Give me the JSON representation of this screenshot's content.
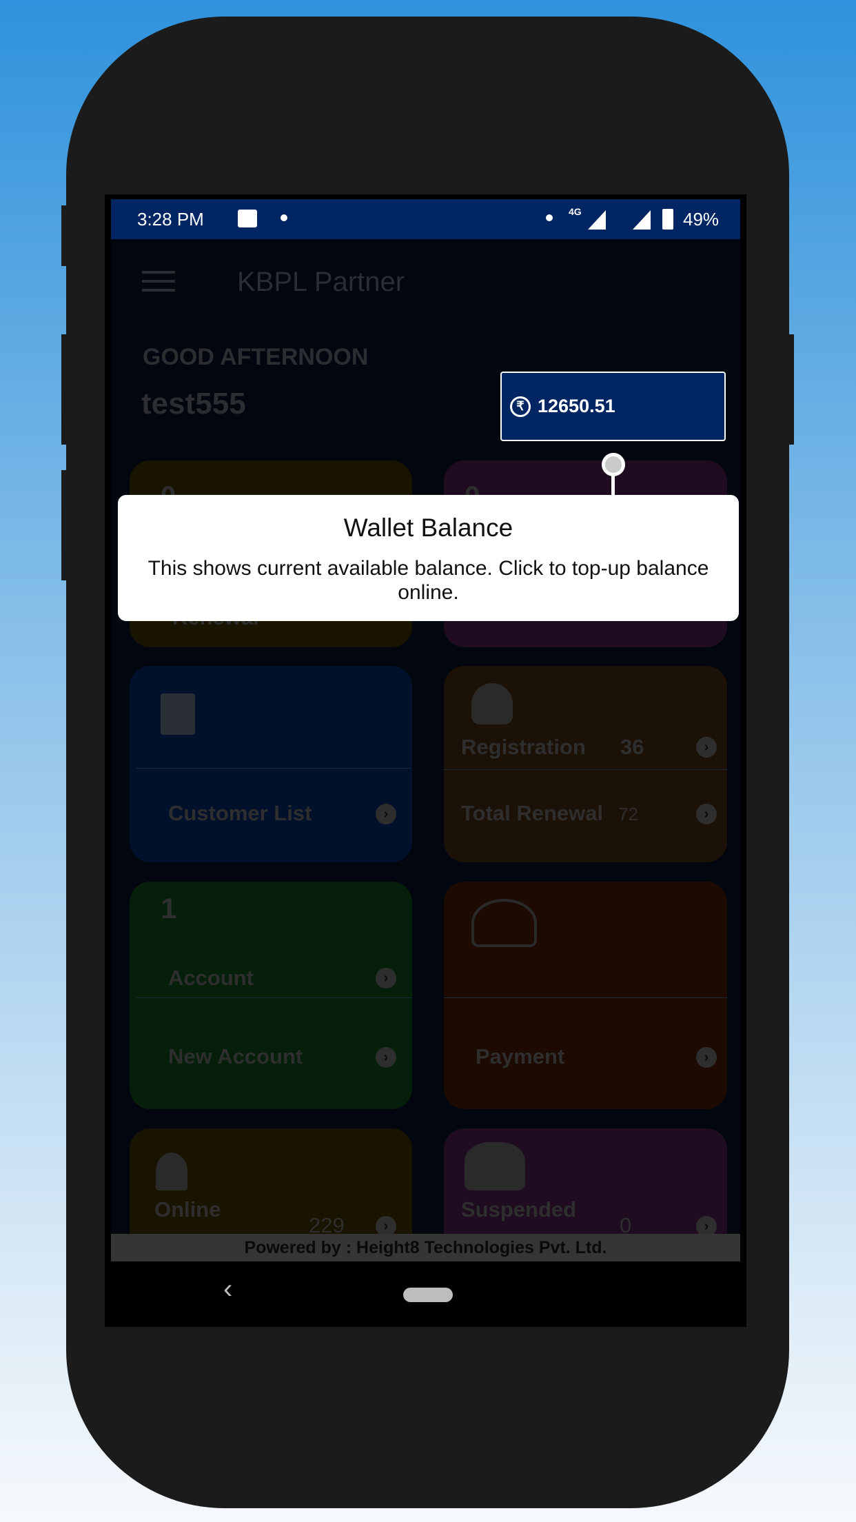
{
  "status_bar": {
    "time": "3:28 PM",
    "network": "4G",
    "battery": "49%"
  },
  "app_bar": {
    "title": "KBPL Partner",
    "menu_icon": "hamburger-icon"
  },
  "greeting": "GOOD AFTERNOON",
  "username": "test555",
  "wallet": {
    "amount": "12650.51",
    "icon": "rupee-icon"
  },
  "tooltip": {
    "title": "Wallet Balance",
    "body": "This shows current available balance. Click to top-up balance online."
  },
  "cards": {
    "renewal": {
      "count": "0",
      "label": "Renewal"
    },
    "top_right": {
      "count": "0"
    },
    "customer_list": {
      "label": "Customer List"
    },
    "registration": {
      "label": "Registration",
      "count": "36",
      "total_label": "Total Renewal",
      "total_count": "72"
    },
    "account": {
      "count": "1",
      "label": "Account",
      "new_label": "New Account"
    },
    "payment": {
      "label": "Payment"
    },
    "online": {
      "label": "Online",
      "count": "229"
    },
    "suspended": {
      "label": "Suspended",
      "count": "0"
    }
  },
  "footer": "Powered by : Height8 Technologies Pvt. Ltd.",
  "colors": {
    "status_bar": "#002563",
    "wallet": "#002563",
    "overlay_bg": "#02060f"
  }
}
